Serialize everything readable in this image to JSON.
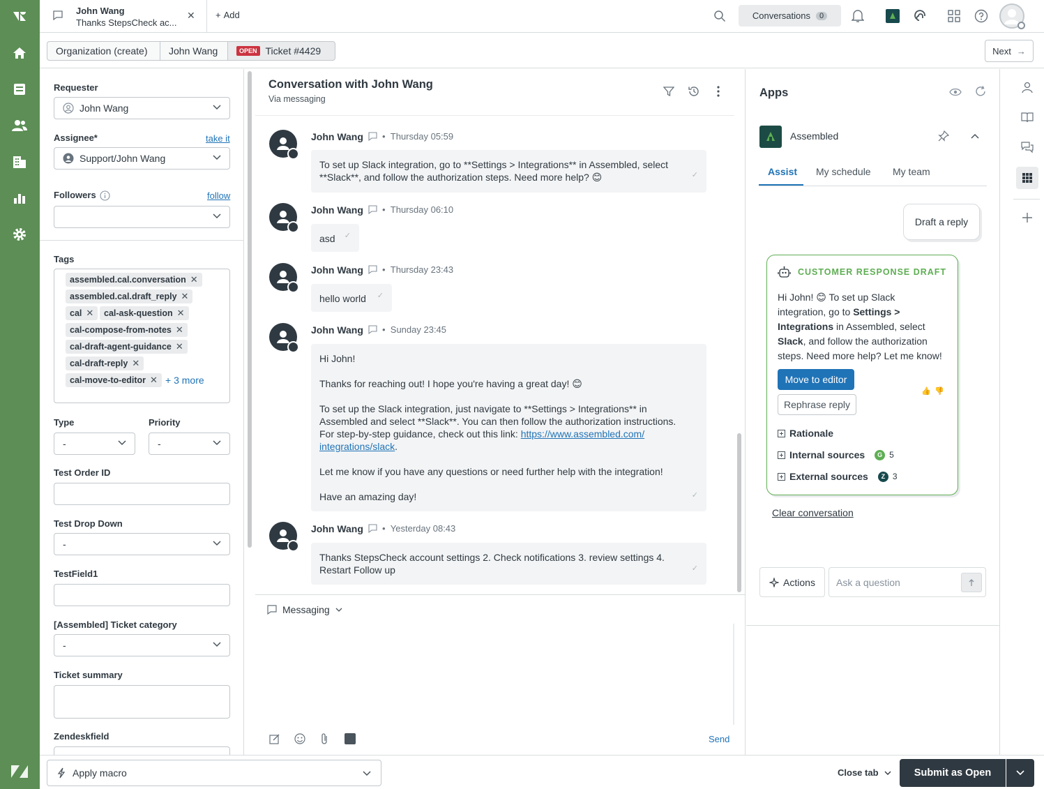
{
  "colors": {
    "nav_bg": "#5c8e55",
    "accent": "#1f73b7",
    "open_badge": "#cc3340",
    "draft_border": "#5eae53",
    "submit_bg": "#2f3941"
  },
  "topbar": {
    "tab_title": "John Wang",
    "tab_subtitle": "Thanks StepsCheck ac...",
    "add_label": "Add",
    "conversations_label": "Conversations",
    "conversations_count": "0"
  },
  "breadcrumb": {
    "org": "Organization (create)",
    "user": "John Wang",
    "status_badge": "OPEN",
    "ticket": "Ticket #4429",
    "next_label": "Next"
  },
  "props": {
    "requester_label": "Requester",
    "requester_value": "John Wang",
    "assignee_label": "Assignee*",
    "take_it": "take it",
    "assignee_value": "Support/John Wang",
    "followers_label": "Followers",
    "follow": "follow",
    "tags_label": "Tags",
    "tags": [
      "assembled.cal.conversation",
      "assembled.cal.draft_reply",
      "cal",
      "cal-ask-question",
      "cal-compose-from-notes",
      "cal-draft-agent-guidance",
      "cal-draft-reply",
      "cal-move-to-editor"
    ],
    "tags_more": "+ 3 more",
    "type_label": "Type",
    "type_value": "-",
    "priority_label": "Priority",
    "priority_value": "-",
    "test_order_label": "Test Order ID",
    "test_drop_label": "Test Drop Down",
    "test_drop_value": "-",
    "testfield1_label": "TestField1",
    "category_label": "[Assembled] Ticket category",
    "category_value": "-",
    "summary_label": "Ticket summary",
    "zendesk_label": "Zendeskfield"
  },
  "conversation": {
    "title": "Conversation with John Wang",
    "subtitle": "Via messaging",
    "messages": [
      {
        "author": "John Wang",
        "time": "Thursday 05:59",
        "lines": [
          "To set up Slack integration, go to **Settings > Integrations** in Assembled, select",
          "**Slack**, and follow the authorization steps. Need more help? 😊"
        ]
      },
      {
        "author": "John Wang",
        "time": "Thursday 06:10",
        "lines": [
          "asd"
        ]
      },
      {
        "author": "John Wang",
        "time": "Thursday 23:43",
        "lines": [
          "hello world"
        ]
      },
      {
        "author": "John Wang",
        "time": "Sunday 23:45",
        "p1": "Hi John!",
        "p2": "Thanks for reaching out! I hope you're having a great day! 😊",
        "p3a": "To set up the Slack integration, just navigate to **Settings > Integrations** in",
        "p3b": "Assembled and select **Slack**. You can then follow the authorization instructions.",
        "p3c": "For step-by-step guidance, check out this link: ",
        "link_a": "https://www.assembled.com/",
        "link_b": "integrations/slack",
        "p4": "Let me know if you have any questions or need further help with the integration!",
        "p5": "Have an amazing day!"
      },
      {
        "author": "John Wang",
        "time": "Yesterday 08:43",
        "lines": [
          "Thanks StepsCheck account settings 2. Check notifications 3. review settings 4.",
          "Restart Follow up"
        ]
      }
    ],
    "composer_channel": "Messaging",
    "send_label": "Send"
  },
  "apps": {
    "title": "Apps",
    "app_name": "Assembled",
    "tabs": [
      "Assist",
      "My schedule",
      "My team"
    ],
    "draft_button": "Draft a reply",
    "draft_header": "CUSTOMER RESPONSE DRAFT",
    "draft_l1": "Hi John! 😊 To set up Slack",
    "draft_l2": "integration, go to ",
    "draft_b1": "Settings >",
    "draft_b2": "Integrations",
    "draft_l3": " in Assembled, select",
    "draft_b3": "Slack",
    "draft_l4": ", and follow the authorization",
    "draft_l5": "steps. Need more help? Let me know!",
    "move_to_editor": "Move to editor",
    "rephrase": "Rephrase reply",
    "rationale": "Rationale",
    "internal_sources": "Internal sources",
    "internal_count": "5",
    "external_sources": "External sources",
    "external_count": "3",
    "clear": "Clear conversation",
    "actions": "Actions",
    "ask_placeholder": "Ask a question"
  },
  "bottom": {
    "macro": "Apply macro",
    "close_tab": "Close tab",
    "submit": "Submit as Open"
  }
}
